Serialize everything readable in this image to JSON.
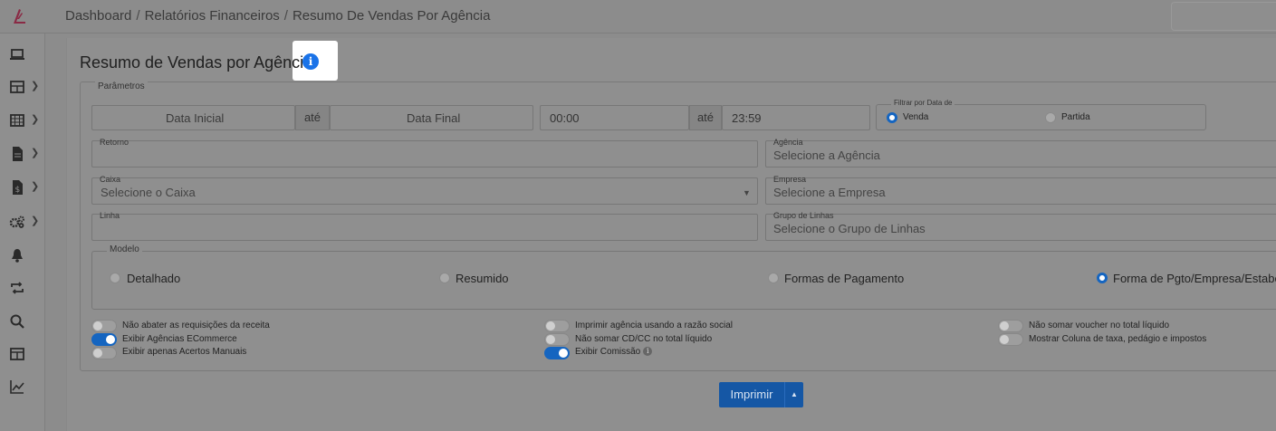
{
  "breadcrumb": [
    "Dashboard",
    "Relatórios Financeiros",
    "Resumo De Vendas Por Agência"
  ],
  "title": "Resumo de Vendas por Agência",
  "params_legend": "Parâmetros",
  "dates": {
    "start_placeholder": "Data Inicial",
    "ate_1": "até",
    "end_placeholder": "Data Final",
    "time_start": "00:00",
    "ate_2": "até",
    "time_end": "23:59"
  },
  "filter_by_date": {
    "legend": "Filtrar por Data de",
    "options": [
      "Venda",
      "Partida"
    ],
    "selected": "Venda"
  },
  "fields": {
    "retorno": {
      "label": "Retorno",
      "placeholder": ""
    },
    "agencia": {
      "label": "Agência",
      "placeholder": "Selecione a Agência"
    },
    "caixa": {
      "label": "Caixa",
      "placeholder": "Selecione o Caixa"
    },
    "empresa": {
      "label": "Empresa",
      "placeholder": "Selecione a Empresa"
    },
    "linha": {
      "label": "Linha",
      "placeholder": ""
    },
    "grupo_linhas": {
      "label": "Grupo de Linhas",
      "placeholder": "Selecione o Grupo de Linhas"
    }
  },
  "modelo": {
    "legend": "Modelo",
    "options": [
      "Detalhado",
      "Resumido",
      "Formas de Pagamento",
      "Forma de Pgto/Empresa/Estabel"
    ],
    "selected": "Forma de Pgto/Empresa/Estabel"
  },
  "toggles": [
    {
      "label": "Não abater as requisições da receita",
      "on": false
    },
    {
      "label": "Exibir Agências ECommerce",
      "on": true
    },
    {
      "label": "Exibir apenas Acertos Manuais",
      "on": false
    },
    {
      "label": "Imprimir agência usando a razão social",
      "on": false
    },
    {
      "label": "Não somar CD/CC no total líquido",
      "on": false
    },
    {
      "label": "Exibir Comissão",
      "on": true
    },
    {
      "label": "Não somar voucher no total líquido",
      "on": false
    },
    {
      "label": "Mostrar Coluna de taxa, pedágio e impostos",
      "on": false
    }
  ],
  "print_button": "Imprimir",
  "colors": {
    "primary": "#1565c0",
    "overlay": "#8f8f8f",
    "info": "#1a73e8"
  },
  "sidebar_icons": [
    "laptop-icon",
    "table-icon",
    "grid-icon",
    "file-icon",
    "dollar-file-icon",
    "gears-icon",
    "bell-icon",
    "sync-icon",
    "search-icon",
    "columns-icon",
    "chart-line-icon"
  ]
}
